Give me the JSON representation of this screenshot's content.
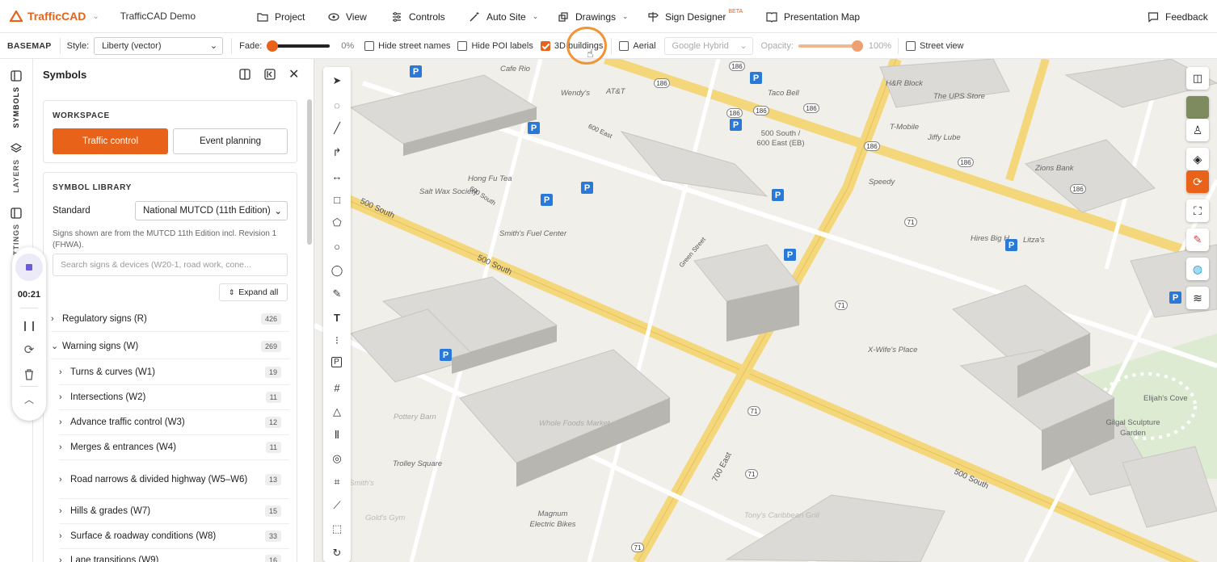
{
  "topbar": {
    "brand": "TrafficCAD",
    "project_name": "TrafficCAD Demo",
    "nav": [
      {
        "label": "Project",
        "icon": "folder-icon"
      },
      {
        "label": "View",
        "icon": "eye-icon"
      },
      {
        "label": "Controls",
        "icon": "sliders-icon"
      },
      {
        "label": "Auto Site",
        "icon": "magic-wand-icon"
      },
      {
        "label": "Drawings",
        "icon": "drawings-icon"
      },
      {
        "label": "Sign Designer",
        "icon": "signpost-icon",
        "badge": "BETA"
      },
      {
        "label": "Presentation Map",
        "icon": "book-icon"
      }
    ],
    "feedback": "Feedback"
  },
  "basemap": {
    "label": "BASEMAP",
    "style_label": "Style:",
    "style_value": "Liberty (vector)",
    "fade_label": "Fade:",
    "fade_value": "0%",
    "fade_fraction": 0,
    "hide_street_names": "Hide street names",
    "hide_poi_labels": "Hide POI labels",
    "buildings_3d": "3D buildings",
    "aerial": "Aerial",
    "aerial_source": "Google Hybrid",
    "opacity_label": "Opacity:",
    "opacity_value": "100%",
    "opacity_fraction": 1,
    "street_view": "Street view"
  },
  "rail": {
    "symbols": "SYMBOLS",
    "layers": "LAYERS",
    "settings": "TTINGS",
    "timer": "00:21"
  },
  "panel": {
    "title": "Symbols",
    "workspace_label": "WORKSPACE",
    "workspace_active": "Traffic control",
    "workspace_other": "Event planning",
    "library_label": "SYMBOL LIBRARY",
    "standard_label": "Standard",
    "standard_value": "National MUTCD (11th Edition)",
    "note": "Signs shown are from the MUTCD 11th Edition incl. Revision 1 (FHWA).",
    "search_placeholder": "Search signs & devices (W20-1, road work, cone...",
    "expand_all": "Expand all",
    "categories": [
      {
        "label": "Regulatory signs (R)",
        "count": "426",
        "expanded": false
      },
      {
        "label": "Warning signs (W)",
        "count": "269",
        "expanded": true
      }
    ],
    "subcategories": [
      {
        "label": "Turns & curves (W1)",
        "count": "19"
      },
      {
        "label": "Intersections (W2)",
        "count": "11"
      },
      {
        "label": "Advance traffic control (W3)",
        "count": "12"
      },
      {
        "label": "Merges & entrances (W4)",
        "count": "11"
      },
      {
        "label": "Road narrows & divided highway (W5–W6)",
        "count": "13"
      },
      {
        "label": "Hills & grades (W7)",
        "count": "15"
      },
      {
        "label": "Surface & roadway conditions (W8)",
        "count": "33"
      },
      {
        "label": "Lane transitions (W9)",
        "count": "16"
      }
    ]
  },
  "map": {
    "streets": [
      "500 South",
      "600 South",
      "500 South",
      "700 East",
      "Green Street",
      "500 South",
      "600 East"
    ],
    "shields": [
      "186",
      "186",
      "186",
      "186",
      "186",
      "186",
      "186",
      "186",
      "71",
      "71",
      "71",
      "71",
      "71"
    ],
    "poi": [
      "Cafe Rio",
      "Wendy's",
      "AT&T",
      "Taco Bell",
      "H&R Block",
      "The UPS Store",
      "T-Mobile",
      "Jiffy Lube",
      "Zions Bank",
      "Salt Wax Society",
      "Hong Fu Tea",
      "Smith's Fuel Center",
      "Hires Big H",
      "X-Wife's Place",
      "Elijah's Cove",
      "Gilgal Sculpture Garden",
      "Pottery Barn",
      "Trolley Square",
      "Whole Foods Market",
      "Magnum Electric Bikes",
      "Tony's Caribbean Grill",
      "Gold's Gym",
      "Smith's",
      "Speedy",
      "Litza's"
    ],
    "transit_label": "500 South / 600 East (EB)"
  }
}
